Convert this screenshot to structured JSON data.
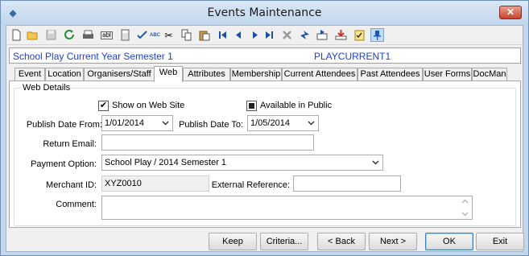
{
  "window": {
    "title": "Events Maintenance",
    "close_glyph": "✕"
  },
  "toolbar": {
    "icons": [
      "new-icon",
      "open-icon",
      "save-icon",
      "refresh-icon",
      "print-icon",
      "field-icon",
      "calculator-icon",
      "approve-icon",
      "spellcheck-icon",
      "cut-icon",
      "copy-icon",
      "paste-icon",
      "first-record-icon",
      "previous-record-icon",
      "next-record-icon",
      "last-record-icon",
      "delete-icon",
      "go-to-icon",
      "mail-icon",
      "download-icon",
      "notes-icon",
      "pin-icon"
    ],
    "spellcheck_label": "ABC",
    "field_label": "abl"
  },
  "header": {
    "name": "School Play Current Year Semester 1",
    "code": "PLAYCURRENT1"
  },
  "tabs": [
    {
      "label": "Event",
      "active": false
    },
    {
      "label": "Location",
      "active": false
    },
    {
      "label": "Organisers/Staff",
      "active": false
    },
    {
      "label": "Web",
      "active": true
    },
    {
      "label": "Attributes",
      "active": false
    },
    {
      "label": "Membership",
      "active": false
    },
    {
      "label": "Current Attendees",
      "active": false
    },
    {
      "label": "Past Attendees",
      "active": false
    },
    {
      "label": "User Forms",
      "active": false
    },
    {
      "label": "DocMan",
      "active": false
    }
  ],
  "web_details": {
    "group_title": "Web Details",
    "show_on_web": {
      "label": "Show on Web Site",
      "checked": true,
      "mark": "✔"
    },
    "available_public": {
      "label": "Available in Public",
      "state": "indeterminate"
    },
    "publish_from": {
      "label": "Publish Date From:",
      "value": "1/01/2014"
    },
    "publish_to": {
      "label": "Publish Date To:",
      "value": "1/05/2014"
    },
    "return_email": {
      "label": "Return Email:",
      "value": ""
    },
    "payment_option": {
      "label": "Payment Option:",
      "value": "School Play / 2014 Semester 1"
    },
    "merchant_id": {
      "label": "Merchant ID:",
      "value": "XYZ0010"
    },
    "external_reference": {
      "label": "External Reference:",
      "value": ""
    },
    "comment": {
      "label": "Comment:",
      "value": ""
    }
  },
  "buttons": {
    "keep": "Keep",
    "criteria": "Criteria...",
    "back": "< Back",
    "next": "Next >",
    "ok": "OK",
    "exit": "Exit"
  }
}
